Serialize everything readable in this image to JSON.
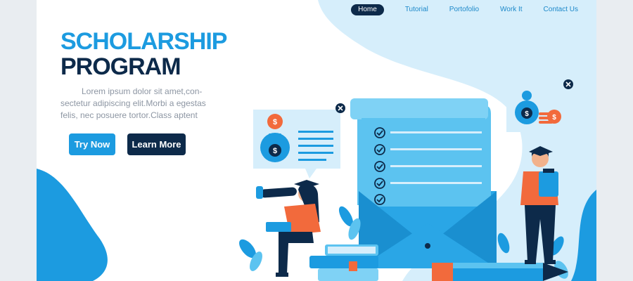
{
  "nav": {
    "items": [
      "Home",
      "Tutorial",
      "Portofolio",
      "Work It",
      "Contact Us"
    ],
    "active": "Home"
  },
  "hero": {
    "title_line1": "SCHOLARSHIP",
    "title_line2": "PROGRAM",
    "description": "Lorem ipsum dolor sit amet,con-sectetur adipiscing elit.Morbi a egestas felis, nec posuere tortor.Class aptent",
    "try_label": "Try Now",
    "learn_label": "Learn More"
  },
  "icons": {
    "money_bag": "$",
    "coin": "$"
  },
  "colors": {
    "primary_blue": "#1c9be0",
    "navy": "#0d2a4a",
    "light_blue": "#d6eefb",
    "orange": "#f26a3c"
  }
}
